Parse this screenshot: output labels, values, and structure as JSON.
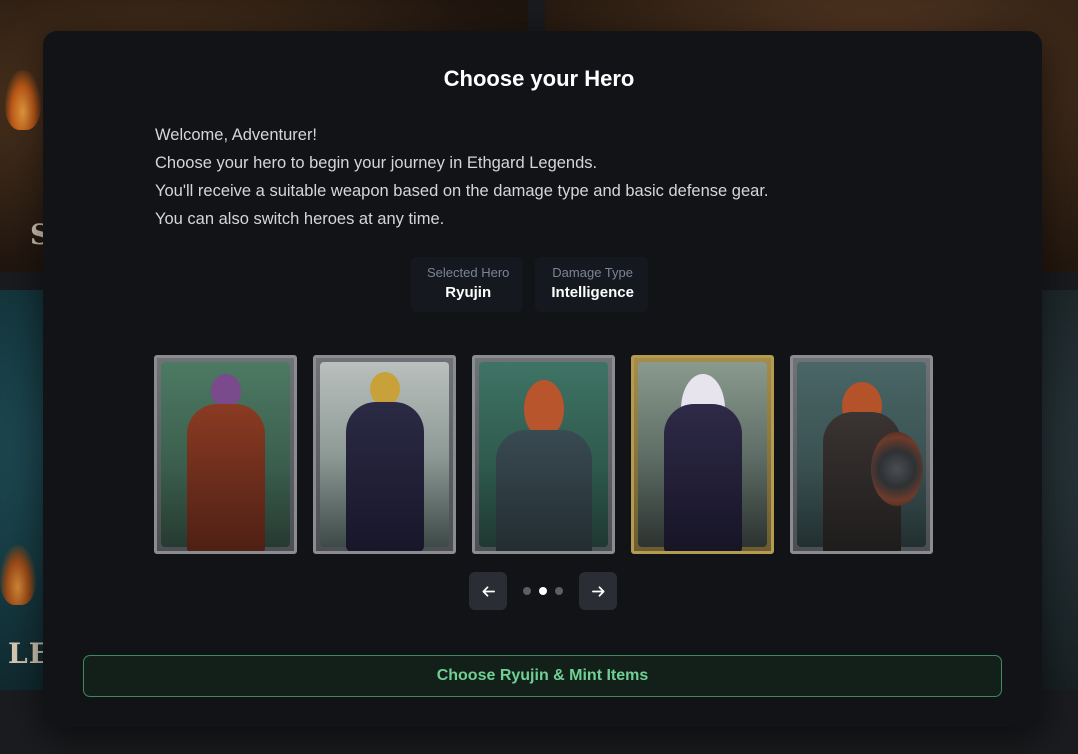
{
  "background": {
    "tile_letters_1": "S",
    "tile_letters_2": "LE"
  },
  "modal": {
    "title": "Choose your Hero",
    "intro_lines": [
      "Welcome, Adventurer!",
      "Choose your hero to begin your journey in Ethgard Legends.",
      "You'll receive a suitable weapon based on the damage type and basic defense gear.",
      "You can also switch heroes at any time."
    ],
    "stats": {
      "selected_hero_label": "Selected Hero",
      "selected_hero_value": "Ryujin",
      "damage_type_label": "Damage Type",
      "damage_type_value": "Intelligence"
    },
    "heroes": [
      {
        "icon": "sorcerer-hero-card",
        "frame": "silver"
      },
      {
        "icon": "samurai-hero-card",
        "frame": "silver"
      },
      {
        "icon": "dwarf-hero-card",
        "frame": "silver"
      },
      {
        "icon": "kitsune-hero-card",
        "frame": "gold"
      },
      {
        "icon": "shieldmaiden-hero-card",
        "frame": "silver"
      }
    ],
    "carousel": {
      "prev_icon": "arrow-left-icon",
      "next_icon": "arrow-right-icon",
      "page_count": 3,
      "active_page": 2
    },
    "cta_label": "Choose Ryujin & Mint Items"
  },
  "colors": {
    "modal_bg": "#111316",
    "accent_green": "#6fcf94",
    "gold_frame": "#b39b52"
  }
}
